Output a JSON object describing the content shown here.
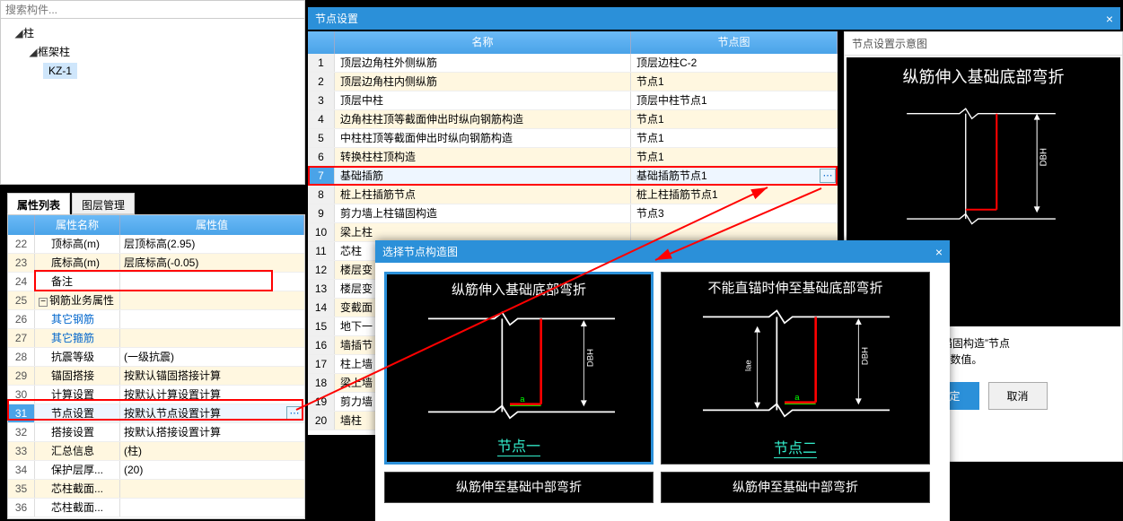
{
  "search": {
    "placeholder": "搜索构件..."
  },
  "tree": {
    "n1": "柱",
    "n2": "框架柱",
    "n3": "KZ-1"
  },
  "tabs": {
    "t1": "属性列表",
    "t2": "图层管理"
  },
  "propHeader": {
    "c1": "属性名称",
    "c2": "属性值"
  },
  "props": [
    {
      "n": "22",
      "name": "顶标高(m)",
      "val": "层顶标高(2.95)"
    },
    {
      "n": "23",
      "name": "底标高(m)",
      "val": "层底标高(-0.05)"
    },
    {
      "n": "24",
      "name": "备注",
      "val": ""
    },
    {
      "n": "25",
      "name": "钢筋业务属性",
      "val": "",
      "minus": true,
      "noindent": true
    },
    {
      "n": "26",
      "name": "其它钢筋",
      "val": "",
      "link": true
    },
    {
      "n": "27",
      "name": "其它箍筋",
      "val": "",
      "link": true
    },
    {
      "n": "28",
      "name": "抗震等级",
      "val": "(一级抗震)"
    },
    {
      "n": "29",
      "name": "锚固搭接",
      "val": "按默认锚固搭接计算"
    },
    {
      "n": "30",
      "name": "计算设置",
      "val": "按默认计算设置计算"
    },
    {
      "n": "31",
      "name": "节点设置",
      "val": "按默认节点设置计算",
      "ell": true,
      "sel": true
    },
    {
      "n": "32",
      "name": "搭接设置",
      "val": "按默认搭接设置计算"
    },
    {
      "n": "33",
      "name": "汇总信息",
      "val": "(柱)"
    },
    {
      "n": "34",
      "name": "保护层厚...",
      "val": "(20)"
    },
    {
      "n": "35",
      "name": "芯柱截面...",
      "val": ""
    },
    {
      "n": "36",
      "name": "芯柱截面...",
      "val": ""
    }
  ],
  "nodeDialog": {
    "title": "节点设置"
  },
  "nodeHeader": {
    "c1": "名称",
    "c2": "节点图"
  },
  "nodeRows": [
    {
      "n": "1",
      "name": "顶层边角柱外侧纵筋",
      "node": "顶层边柱C-2"
    },
    {
      "n": "2",
      "name": "顶层边角柱内侧纵筋",
      "node": "节点1"
    },
    {
      "n": "3",
      "name": "顶层中柱",
      "node": "顶层中柱节点1"
    },
    {
      "n": "4",
      "name": "边角柱柱顶等截面伸出时纵向钢筋构造",
      "node": "节点1"
    },
    {
      "n": "5",
      "name": "中柱柱顶等截面伸出时纵向钢筋构造",
      "node": "节点1"
    },
    {
      "n": "6",
      "name": "转换柱柱顶构造",
      "node": "节点1"
    },
    {
      "n": "7",
      "name": "基础插筋",
      "node": "基础插筋节点1",
      "sel": true,
      "ell": true
    },
    {
      "n": "8",
      "name": "桩上柱插筋节点",
      "node": "桩上柱插筋节点1"
    },
    {
      "n": "9",
      "name": "剪力墙上柱锚固构造",
      "node": "节点3"
    },
    {
      "n": "10",
      "name": "梁上柱",
      "node": ""
    },
    {
      "n": "11",
      "name": "芯柱",
      "node": ""
    },
    {
      "n": "12",
      "name": "楼层变",
      "node": ""
    },
    {
      "n": "13",
      "name": "楼层变",
      "node": ""
    },
    {
      "n": "14",
      "name": "变截面",
      "node": ""
    },
    {
      "n": "15",
      "name": "地下一",
      "node": ""
    },
    {
      "n": "16",
      "name": "墙插节",
      "node": ""
    },
    {
      "n": "17",
      "name": "柱上墙",
      "node": ""
    },
    {
      "n": "18",
      "name": "梁上墙",
      "node": ""
    },
    {
      "n": "19",
      "name": "剪力墙",
      "node": ""
    },
    {
      "n": "20",
      "name": "墙柱",
      "node": ""
    }
  ],
  "diagram": {
    "title": "节点设置示意图",
    "main": "纵筋伸入基础底部弯折",
    "nodeLabel": "点一",
    "desc": "的“柱插筋在基础中锚固构造”节点\n长度 a 取计算设置中数值。",
    "ok": "确定",
    "cancel": "取消"
  },
  "selectDialog": {
    "title": "选择节点构造图",
    "thumbs": [
      {
        "title": "纵筋伸入基础底部弯折",
        "label": "节点一",
        "sel": true,
        "dim": "DBH",
        "a": "a"
      },
      {
        "title": "不能直锚时伸至基础底部弯折",
        "label": "节点二",
        "dim": "DBH",
        "lae": "lae",
        "a": "a"
      }
    ],
    "half": [
      {
        "title": "纵筋伸至基础中部弯折"
      },
      {
        "title": "纵筋伸至基础中部弯折"
      }
    ]
  }
}
